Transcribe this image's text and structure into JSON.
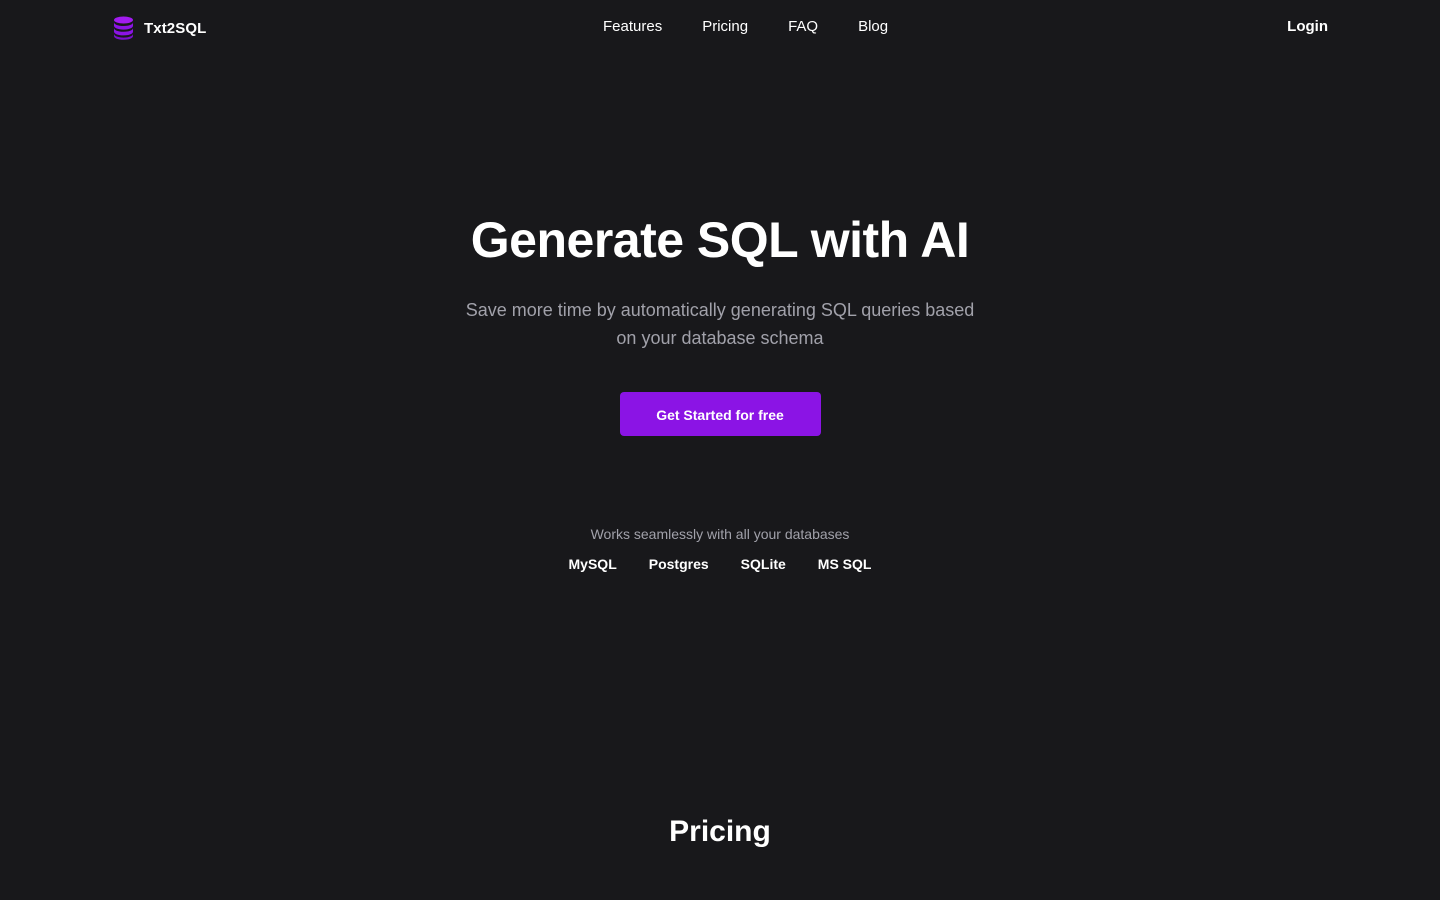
{
  "nav": {
    "brand": "Txt2SQL",
    "links": [
      "Features",
      "Pricing",
      "FAQ",
      "Blog"
    ],
    "login": "Login"
  },
  "hero": {
    "title": "Generate SQL with AI",
    "subtitle": "Save more time by automatically generating SQL queries based on your database schema",
    "cta": "Get Started for free"
  },
  "databases": {
    "caption": "Works seamlessly with all your databases",
    "items": [
      "MySQL",
      "Postgres",
      "SQLite",
      "MS SQL"
    ]
  },
  "pricing": {
    "heading": "Pricing"
  },
  "colors": {
    "background": "#18181b",
    "accent": "#8b14e5",
    "muted_text": "#a1a1aa"
  },
  "icons": {
    "brand": "database-icon"
  }
}
